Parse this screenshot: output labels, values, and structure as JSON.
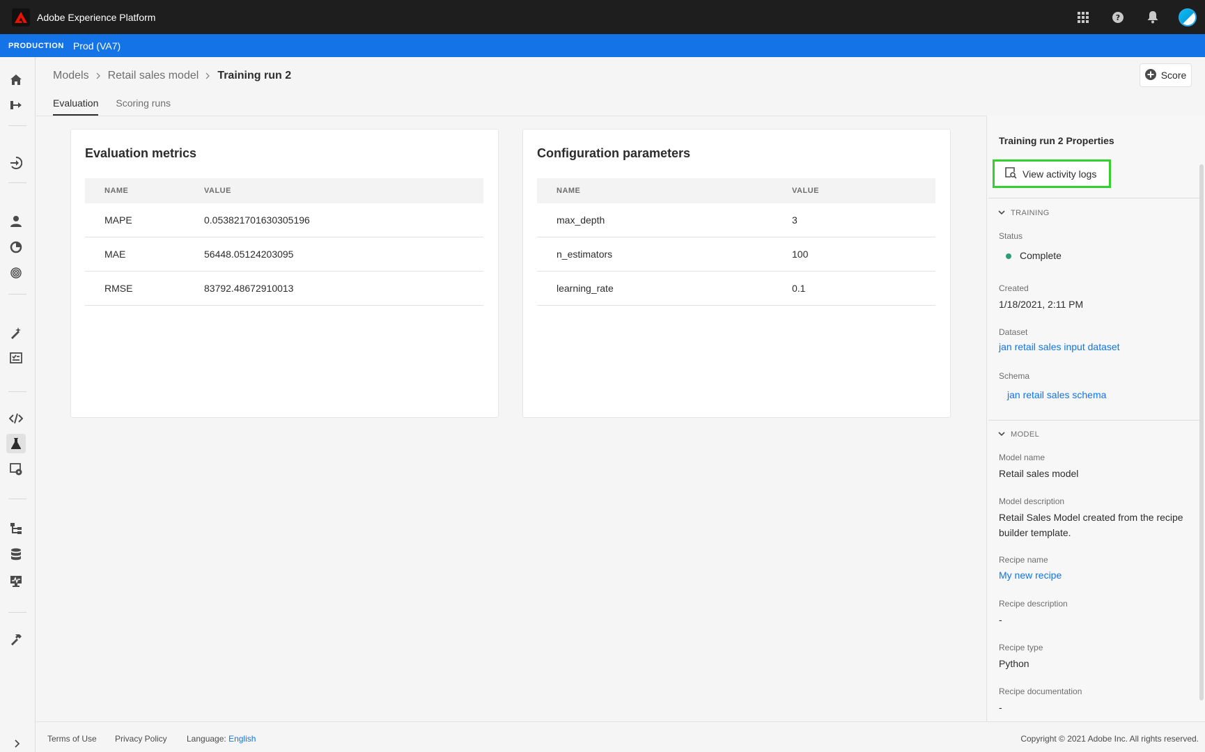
{
  "header": {
    "app_title": "Adobe Experience Platform",
    "icons": [
      "apps-grid-icon",
      "help-icon",
      "notifications-bell-icon",
      "user-avatar"
    ]
  },
  "environment": {
    "label": "PRODUCTION",
    "name": "Prod (VA7)"
  },
  "leftnav": {
    "items": [
      "home",
      "workflows",
      "sources",
      "profiles",
      "segments",
      "identities",
      "data-science-workspace",
      "models",
      "notebooks",
      "ml-models-active",
      "services",
      "schemas",
      "datasets",
      "monitoring",
      "tools"
    ]
  },
  "breadcrumb": {
    "items": [
      "Models",
      "Retail sales model"
    ],
    "current": "Training run 2"
  },
  "score_button": {
    "label": "Score"
  },
  "tabs": [
    {
      "label": "Evaluation",
      "active": true
    },
    {
      "label": "Scoring runs",
      "active": false
    }
  ],
  "evaluation": {
    "title": "Evaluation metrics",
    "columns": [
      "NAME",
      "VALUE"
    ],
    "rows": [
      {
        "name": "MAPE",
        "value": "0.053821701630305196"
      },
      {
        "name": "MAE",
        "value": "56448.05124203095"
      },
      {
        "name": "RMSE",
        "value": "83792.48672910013"
      }
    ]
  },
  "configuration": {
    "title": "Configuration parameters",
    "columns": [
      "NAME",
      "VALUE"
    ],
    "rows": [
      {
        "name": "max_depth",
        "value": "3"
      },
      {
        "name": "n_estimators",
        "value": "100"
      },
      {
        "name": "learning_rate",
        "value": "0.1"
      }
    ]
  },
  "properties": {
    "title": "Training run 2 Properties",
    "view_logs_label": "View activity logs",
    "training": {
      "section_label": "TRAINING",
      "status_label": "Status",
      "status_value": "Complete",
      "created_label": "Created",
      "created_value": "1/18/2021, 2:11 PM",
      "dataset_label": "Dataset",
      "dataset_value": "jan retail sales input dataset",
      "schema_label": "Schema",
      "schema_value": "jan retail sales schema"
    },
    "model": {
      "section_label": "MODEL",
      "name_label": "Model name",
      "name_value": "Retail sales model",
      "description_label": "Model description",
      "description_value": "Retail Sales Model created from the recipe builder template.",
      "recipe_name_label": "Recipe name",
      "recipe_name_value": "My new recipe",
      "recipe_description_label": "Recipe description",
      "recipe_description_value": "-",
      "recipe_type_label": "Recipe type",
      "recipe_type_value": "Python",
      "recipe_documentation_label": "Recipe documentation",
      "recipe_documentation_value": "-"
    }
  },
  "footer": {
    "terms": "Terms of Use",
    "privacy": "Privacy Policy",
    "language_label": "Language:",
    "language_value": "English",
    "copyright": "Copyright © 2021 Adobe Inc. All rights reserved."
  },
  "colors": {
    "header_bg": "#1e1e1e",
    "env_bar": "#1473e6",
    "link": "#1473e6",
    "highlight_border": "#33d130",
    "status_complete": "#2d9d78",
    "adobe_red": "#eb1000"
  }
}
